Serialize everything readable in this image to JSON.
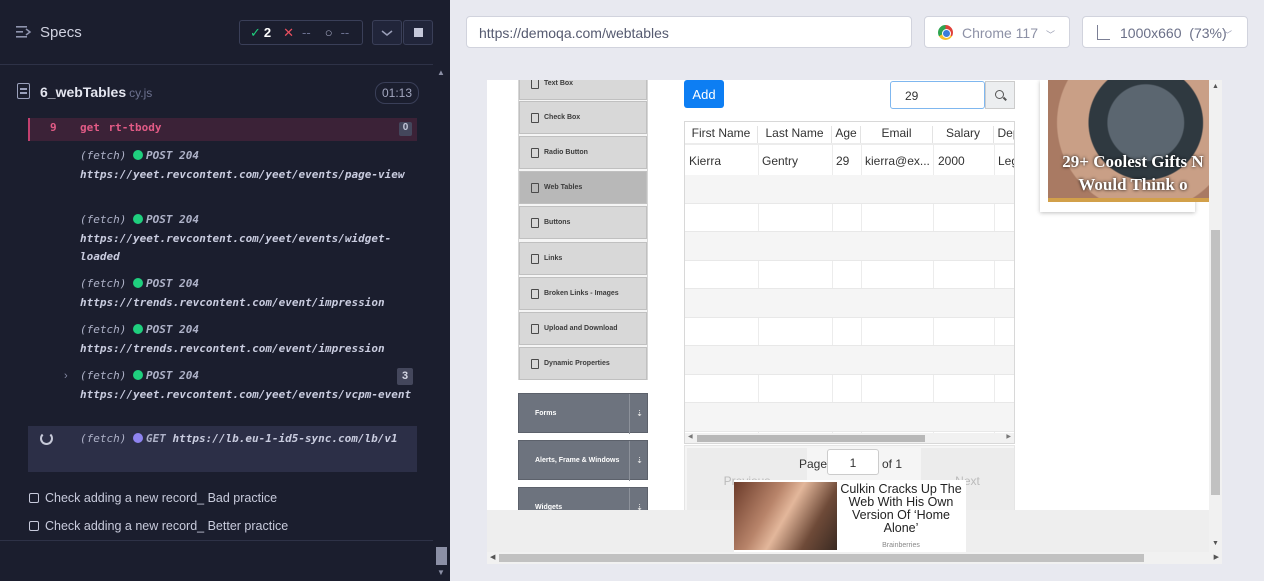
{
  "runner": {
    "specs_label": "Specs",
    "passed_count": "2",
    "failed_count": "--",
    "pending_count": "--",
    "file_name": "6_webTables",
    "file_ext": "cy.js",
    "duration": "01:13",
    "command": {
      "number": "9",
      "text": "get  rt-tbody",
      "badge": "0"
    },
    "logs": [
      {
        "prefix": "(fetch)",
        "status": "POST 204",
        "url": "https://yeet.revcontent.com/yeet/events/page-view"
      },
      {
        "prefix": "(fetch)",
        "status": "POST 204",
        "url": "https://yeet.revcontent.com/yeet/events/widget-loaded"
      },
      {
        "prefix": "(fetch)",
        "status": "POST 204",
        "url": "https://trends.revcontent.com/event/impression"
      },
      {
        "prefix": "(fetch)",
        "status": "POST 204",
        "url": "https://trends.revcontent.com/event/impression"
      },
      {
        "prefix": "(fetch)",
        "status": "POST 204",
        "url": "https://yeet.revcontent.com/yeet/events/vcpm-event",
        "badge": "3"
      }
    ],
    "pending_log": {
      "prefix": "(fetch)",
      "method": "GET",
      "url": "https://lb.eu-1-id5-sync.com/lb/v1"
    },
    "tests": [
      "Check adding a new record_ Bad practice",
      "Check adding a new record_ Better practice"
    ]
  },
  "browser": {
    "url": "https://demoqa.com/webtables",
    "name": "Chrome 117",
    "viewport": "1000x660",
    "zoom": "(73%)"
  },
  "app": {
    "nav_items": [
      "Text Box",
      "Check Box",
      "Radio Button",
      "Web Tables",
      "Buttons",
      "Links",
      "Broken Links - Images",
      "Upload and Download",
      "Dynamic Properties"
    ],
    "sections": [
      "Forms",
      "Alerts, Frame & Windows",
      "Widgets"
    ],
    "add_label": "Add",
    "search_value": "29",
    "columns": [
      "First Name",
      "Last Name",
      "Age",
      "Email",
      "Salary",
      "Dep"
    ],
    "rows": [
      [
        "Kierra",
        "Gentry",
        "29",
        "kierra@ex...",
        "2000",
        "Leg"
      ]
    ],
    "pager": {
      "previous": "Previous",
      "page_label": "Page",
      "page_value": "1",
      "of_label": "of 1",
      "next": "Next"
    },
    "side_ad_caption": "29+ Coolest Gifts N Would Think o",
    "bottom_ad": {
      "headline": "Culkin Cracks Up The Web With His Own Version Of ‘Home Alone’",
      "brand": "Brainberries"
    }
  },
  "colors": {
    "pass": "#1fcf7e",
    "fail": "#e94f5f",
    "command": "#e25b86",
    "add_button": "#0d7ef3"
  }
}
